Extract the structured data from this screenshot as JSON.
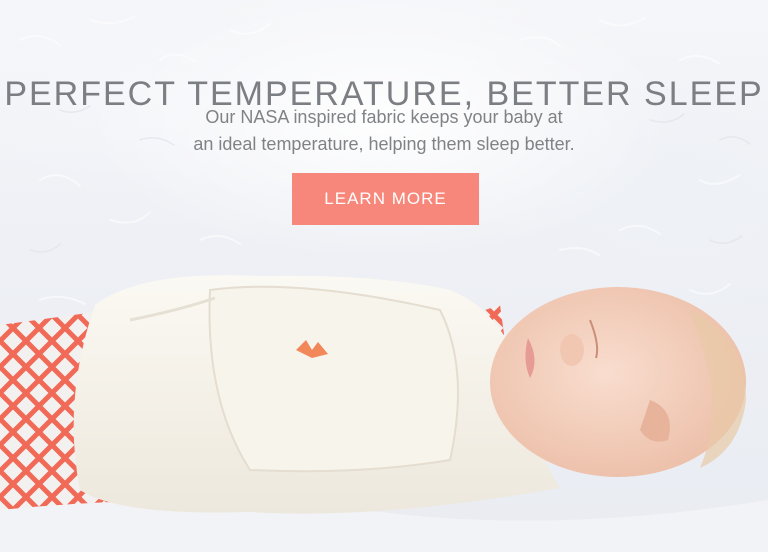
{
  "hero": {
    "headline": "PERFECT TEMPERATURE, BETTER SLEEP",
    "subtext_line1": "Our NASA inspired fabric keeps your baby at",
    "subtext_line2": "an ideal temperature, helping them sleep better.",
    "cta_label": "LEARN MORE"
  },
  "colors": {
    "accent": "#f7877a",
    "heading_text": "#7b7e82",
    "body_text": "#808386",
    "background": "#eef0f5"
  },
  "image": {
    "subject": "sleeping newborn swaddled in cream wrap on white fur, coral patterned blanket",
    "icon": "orange-bird-logo-icon"
  }
}
